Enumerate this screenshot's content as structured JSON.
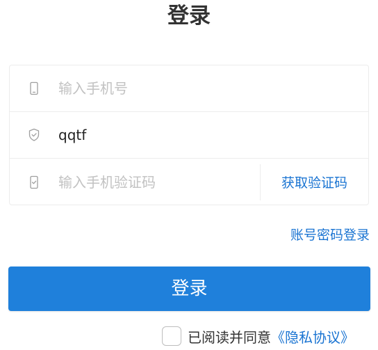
{
  "header": {
    "title": "登录"
  },
  "form": {
    "phone": {
      "icon": "mobile-phone-icon",
      "placeholder": "输入手机号",
      "value": ""
    },
    "password": {
      "icon": "shield-icon",
      "placeholder": "",
      "value": "qqtf"
    },
    "code": {
      "icon": "phone-check-icon",
      "placeholder": "输入手机验证码",
      "value": "",
      "get_code_label": "获取验证码"
    }
  },
  "links": {
    "account_password_login": "账号密码登录"
  },
  "actions": {
    "login_label": "登录"
  },
  "agreement": {
    "checked": false,
    "text": "已阅读并同意",
    "link_label": "《隐私协议》"
  },
  "colors": {
    "accent": "#1a74d2",
    "button": "#1f80db",
    "border": "#ececec",
    "placeholder": "#c2c2c2"
  }
}
